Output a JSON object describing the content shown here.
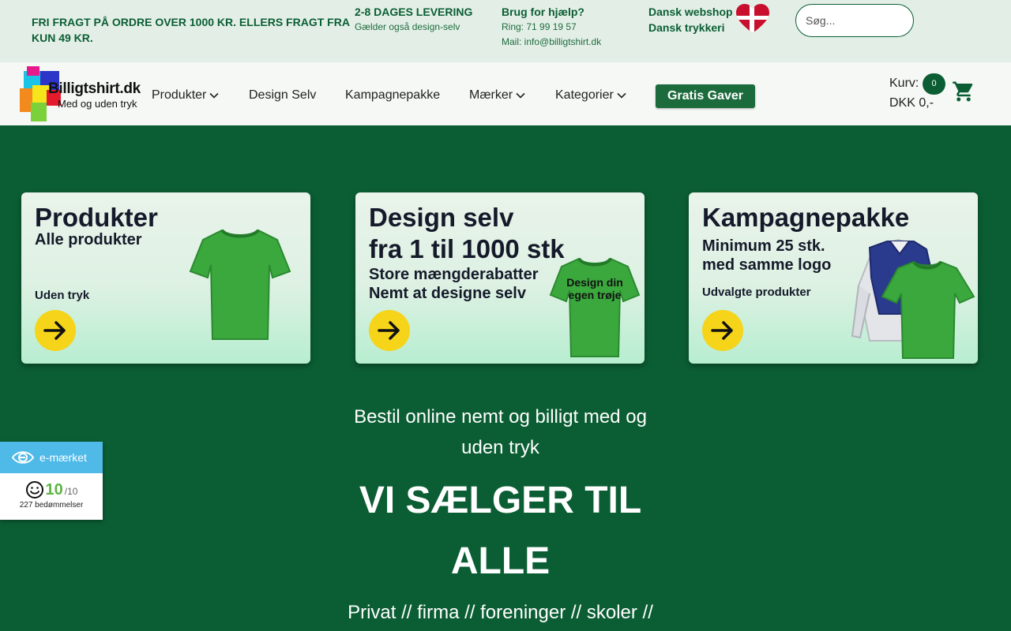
{
  "topbar": {
    "shipping": "FRI FRAGT PÅ ORDRE OVER 1000 KR. ELLERS FRAGT FRA KUN 49 KR.",
    "delivery": {
      "head": "2-8 DAGES LEVERING",
      "sub": "Gælder også design-selv"
    },
    "help": {
      "head": "Brug for hjælp?",
      "phone": "Ring: 71 99 19 57",
      "mail": "Mail: info@billigtshirt.dk"
    },
    "danish": {
      "line1": "Dansk webshop",
      "line2": "Dansk trykkeri"
    },
    "search": {
      "placeholder": "Søg..."
    }
  },
  "nav": {
    "logo": {
      "name": "Billigtshirt.dk",
      "tagline": "Med og uden tryk"
    },
    "items": [
      {
        "label": "Produkter",
        "dropdown": true
      },
      {
        "label": "Design Selv",
        "dropdown": false
      },
      {
        "label": "Kampagnepakke",
        "dropdown": false
      },
      {
        "label": "Mærker",
        "dropdown": true
      },
      {
        "label": "Kategorier",
        "dropdown": true
      }
    ],
    "gift_button": "Gratis Gaver",
    "cart": {
      "label": "Kurv:",
      "count": "0",
      "total": "DKK 0,-"
    }
  },
  "cards": [
    {
      "title": "Produkter",
      "sub": "Alle produkter",
      "small": "Uden tryk"
    },
    {
      "title1": "Design selv",
      "title2": "fra 1 til 1000 stk",
      "sub1": "Store mængderabatter",
      "sub2": "Nemt at designe selv",
      "shirt_text": "Design din egen trøje"
    },
    {
      "title": "Kampagnepakke",
      "sub1": "Minimum 25 stk.",
      "sub2": "med samme logo",
      "small": "Udvalgte produkter"
    }
  ],
  "hero": {
    "subtitle": "Bestil online nemt og billigt med og uden tryk",
    "title": "VI SÆLGER TIL ALLE",
    "audience": "Privat // firma // foreninger // skoler //"
  },
  "emark": {
    "brand": "e-mærket",
    "score": "10",
    "scale": "/10",
    "reviews": "227 bedømmelser"
  },
  "colors": {
    "brand_green": "#0b5e34",
    "topbar_bg": "#e3efe6",
    "accent_yellow": "#f5d419",
    "emark_blue": "#4fb9e8"
  }
}
